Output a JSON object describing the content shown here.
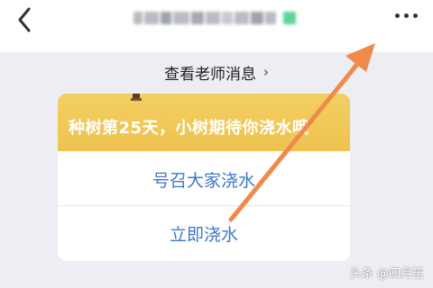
{
  "header": {
    "back_icon": "chevron-left-icon",
    "more_icon": "more-dots-icon",
    "title_redacted": true
  },
  "teacher_link": {
    "label": "查看老师消息",
    "chevron": "›"
  },
  "dialog": {
    "banner_text": "种树第25天，小树期待你浇水哦",
    "banner_color": "#efc552",
    "buttons": [
      {
        "label": "号召大家浇水"
      },
      {
        "label": "立即浇水"
      }
    ],
    "button_color": "#3d79c9"
  },
  "annotation": {
    "arrow_color": "#f08a4b"
  },
  "watermark": {
    "text": "头条 @四月笙"
  }
}
